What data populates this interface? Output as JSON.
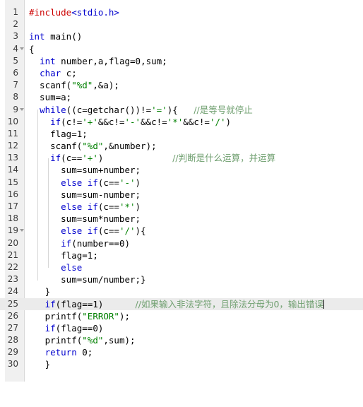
{
  "editor": {
    "name": "code-editor",
    "language": "c",
    "total_lines": 30,
    "current_line": 25,
    "colors": {
      "background": "#ffffff",
      "gutter_background": "#f0f0f0",
      "current_line_highlight": "#ebebeb",
      "keyword": "#0000cd",
      "preprocessor": "#cc0000",
      "string": "#008000",
      "comment": "#6f9f6f",
      "line_number": "#3a3a3a",
      "indent_guide": "#d6d6d6",
      "fold_marker": "#999999"
    },
    "fold_markers": [
      4,
      9,
      19
    ]
  },
  "lines": [
    {
      "n": "1",
      "text": "#include<stdio.h>"
    },
    {
      "n": "2",
      "text": ""
    },
    {
      "n": "3",
      "text": "int main()"
    },
    {
      "n": "4",
      "text": "{"
    },
    {
      "n": "5",
      "text": "  int number,a,flag=0,sum;"
    },
    {
      "n": "6",
      "text": "  char c;"
    },
    {
      "n": "7",
      "text": "  scanf(\"%d\",&a);"
    },
    {
      "n": "8",
      "text": "  sum=a;"
    },
    {
      "n": "9",
      "text": "  while((c=getchar())!='='){   //是等号就停止"
    },
    {
      "n": "10",
      "text": "    if(c!='+'&&c!='-'&&c!='*'&&c!='/')"
    },
    {
      "n": "11",
      "text": "    flag=1;"
    },
    {
      "n": "12",
      "text": "    scanf(\"%d\",&number);"
    },
    {
      "n": "13",
      "text": "    if(c=='+')             //判断是什么运算，并运算"
    },
    {
      "n": "14",
      "text": "      sum=sum+number;"
    },
    {
      "n": "15",
      "text": "      else if(c=='-')"
    },
    {
      "n": "16",
      "text": "      sum=sum-number;"
    },
    {
      "n": "17",
      "text": "      else if(c=='*')"
    },
    {
      "n": "18",
      "text": "      sum=sum*number;"
    },
    {
      "n": "19",
      "text": "      else if(c=='/'){"
    },
    {
      "n": "20",
      "text": "      if(number==0)"
    },
    {
      "n": "21",
      "text": "      flag=1;"
    },
    {
      "n": "22",
      "text": "      else"
    },
    {
      "n": "23",
      "text": "      sum=sum/number;}"
    },
    {
      "n": "24",
      "text": "   }"
    },
    {
      "n": "25",
      "text": "   if(flag==1)      //如果输入非法字符，且除法分母为0，输出错误"
    },
    {
      "n": "26",
      "text": "   printf(\"ERROR\");"
    },
    {
      "n": "27",
      "text": "   if(flag==0)"
    },
    {
      "n": "28",
      "text": "   printf(\"%d\",sum);"
    },
    {
      "n": "29",
      "text": "   return 0;"
    },
    {
      "n": "30",
      "text": "   }"
    }
  ],
  "comments": {
    "line9": "//是等号就停止",
    "line13": "//判断是什么运算，并运算",
    "line25": "//如果输入非法字符，且除法分母为0，输出错误"
  },
  "strings": {
    "scanf_int": "\"%d\"",
    "error_literal": "\"ERROR\""
  }
}
